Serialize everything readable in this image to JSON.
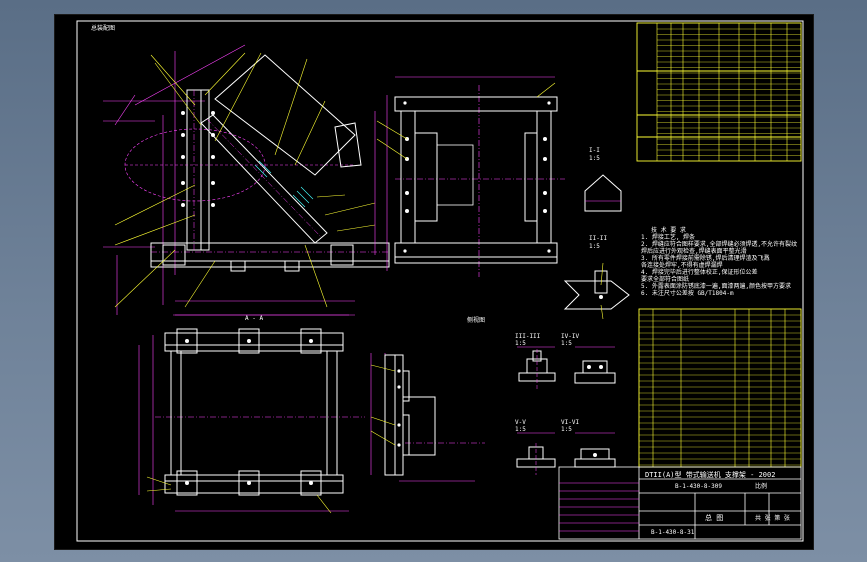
{
  "viewport": {
    "corner_label": "总装配图",
    "views": {
      "section_a": "A - A",
      "side_view": "侧视图",
      "detail_1_title": "I-I",
      "detail_1_scale": "1:5",
      "detail_2_title": "II-II",
      "detail_2_scale": "1:5",
      "detail_3_title": "III-III",
      "detail_3_scale": "1:5",
      "detail_4_title": "IV-IV",
      "detail_4_scale": "1:5",
      "detail_5_title": "V-V",
      "detail_5_scale": "1:5",
      "detail_6_title": "VI-VI",
      "detail_6_scale": "1:5"
    },
    "notes_title": "技 术 要 求",
    "notes": [
      "1. 焊接工艺, 焊条",
      "2. 焊缝应符合图样要求,全部焊缝必须焊透,不允许有裂纹",
      "   焊后应进行外观检查,焊缝表面平整光滑",
      "3. 所有零件焊接前需除锈,焊后清理焊渣及飞溅",
      "   各连接处焊牢,不得有虚焊漏焊",
      "4. 焊接完毕后进行整体校正,保证形位公差",
      "   要求全部符合图纸",
      "5. 外露表面涂防锈底漆一遍,面漆两遍,颜色按甲方要求",
      "6. 未注尺寸公差按 GB/T1804-m"
    ],
    "title_block": {
      "drawing_title": "DTII(A)型 带式输送机 支撑架 - 2002",
      "code": "B-1-430-8-309",
      "assembly": "总 图",
      "scale_label": "比例",
      "sheet_label": "共 张 第 张",
      "company": "B-1-430-8-31"
    }
  },
  "colors": {
    "frame": "#ffffff",
    "part": "#ffffff",
    "dim": "#ff44ff",
    "center": "#ff44ff",
    "leader": "#ffff33",
    "hatch": "#44ffff",
    "table": "#ffff33"
  }
}
